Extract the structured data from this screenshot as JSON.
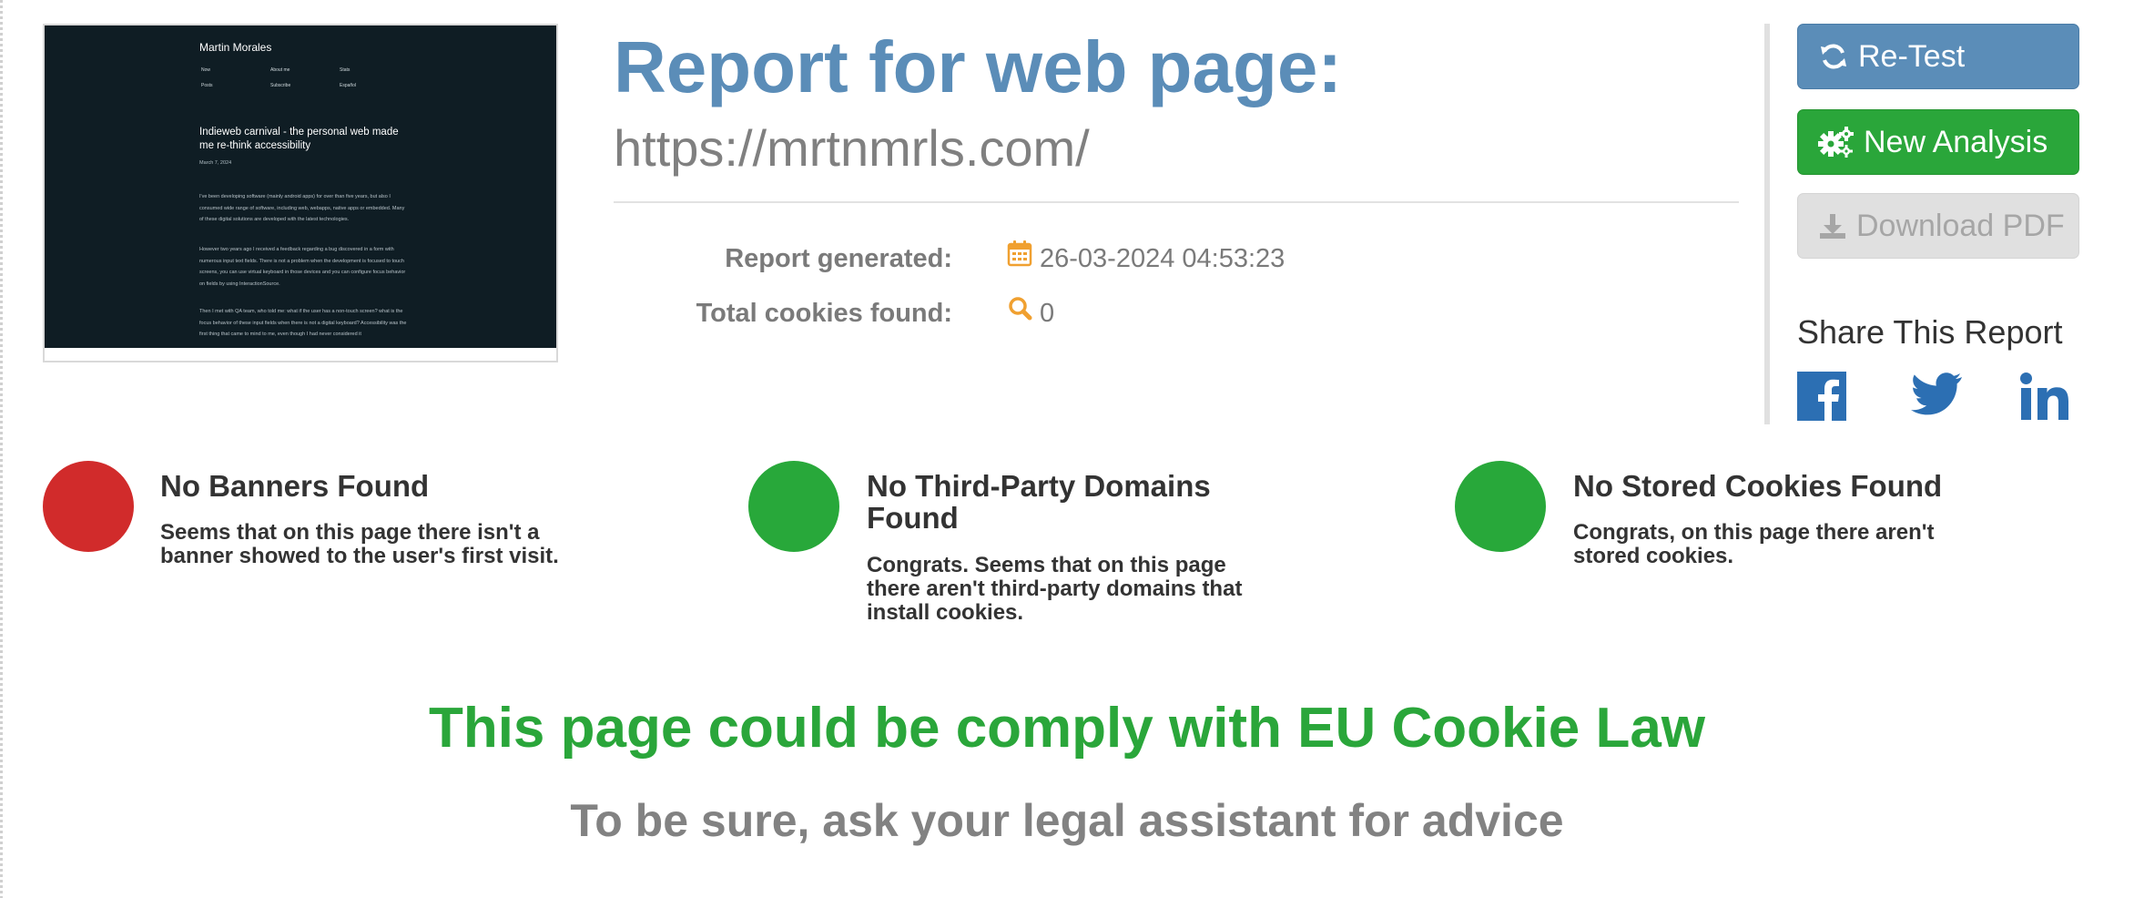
{
  "thumbnail": {
    "site_name": "Martin Morales",
    "nav": [
      "Now",
      "About me",
      "Stats",
      "Posts",
      "Subscribe",
      "Español"
    ],
    "post_title": "Indieweb carnival - the personal web made me re-think accessibility",
    "post_date": "March 7, 2024",
    "paragraphs": [
      "I've been developing software (mainly android apps) for over than five years, but also I consumed wide range of software, including web, webapps, native apps or embedded. Many of these digital solutions are developed with the latest technologies.",
      "However two years ago I received a feedback regarding a bug discovered in a form with numerous input text fields. There is not a problem when the development is focused to touch screens, you can use virtual keyboard in those devices and you can configure focus behavior on fields by using InteractionSource.",
      "Then I met with QA team, who told me: what if the user has a non-touch screen? what is the focus behavior of these input fields when there is not a digital keyboard? Accessibility was the first thing that came to mind to me, even though I had never considered it"
    ]
  },
  "header": {
    "title": "Report for web page:",
    "url": "https://mrtnmrls.com/"
  },
  "meta": {
    "generated_label": "Report generated:",
    "generated_value": "26-03-2024 04:53:23",
    "cookies_label": "Total cookies found:",
    "cookies_value": "0"
  },
  "actions": {
    "retest": "Re-Test",
    "new_analysis": "New Analysis",
    "download_pdf": "Download PDF"
  },
  "share": {
    "title": "Share This Report",
    "networks": [
      "facebook-icon",
      "twitter-icon",
      "linkedin-icon"
    ]
  },
  "results": [
    {
      "status": "red",
      "title": "No Banners Found",
      "text": "Seems that on this page there isn't a banner showed to the user's first visit."
    },
    {
      "status": "green",
      "title": "No Third-Party Domains Found",
      "text": "Congrats. Seems that on this page there aren't third-party domains that install cookies."
    },
    {
      "status": "green",
      "title": "No Stored Cookies Found",
      "text": "Congrats, on this page there aren't stored cookies."
    }
  ],
  "verdict": "This page could be comply with EU Cookie Law",
  "advice": "To be sure, ask your legal assistant for advice",
  "colors": {
    "primary": "#5b8db8",
    "success": "#2aa63a",
    "danger": "#d12b2b",
    "disabled": "#e0e0e0",
    "accent_icon": "#f0a030",
    "social": "#2c6fb3"
  }
}
